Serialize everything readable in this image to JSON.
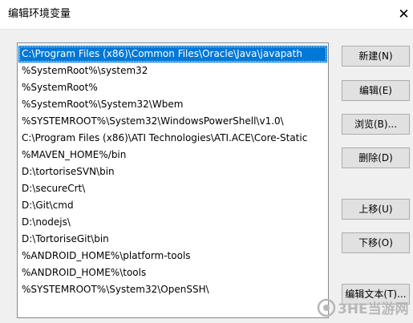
{
  "window": {
    "title": "编辑环境变量",
    "close_glyph": "✕"
  },
  "path_list": {
    "selected_index": 0,
    "items": [
      "C:\\Program Files (x86)\\Common Files\\Oracle\\Java\\javapath",
      "%SystemRoot%\\system32",
      "%SystemRoot%",
      "%SystemRoot%\\System32\\Wbem",
      "%SYSTEMROOT%\\System32\\WindowsPowerShell\\v1.0\\",
      "C:\\Program Files (x86)\\ATI Technologies\\ATI.ACE\\Core-Static",
      "%MAVEN_HOME%/bin",
      "D:\\tortoriseSVN\\bin",
      "D:\\secureCrt\\",
      "D:\\Git\\cmd",
      "D:\\nodejs\\",
      "D:\\TortoriseGit\\bin",
      "%ANDROID_HOME%\\platform-tools",
      "%ANDROID_HOME%\\tools",
      "%SYSTEMROOT%\\System32\\OpenSSH\\"
    ]
  },
  "buttons": {
    "new": "新建(N)",
    "edit": "编辑(E)",
    "browse": "浏览(B)...",
    "delete": "删除(D)",
    "move_up": "上移(U)",
    "move_down": "下移(O)",
    "edit_text": "编辑文本(T)..."
  },
  "watermark": {
    "text": "3HE当游网"
  },
  "colors": {
    "selection": "#0078d7",
    "dialog_background": "#f0f0f0",
    "button_face": "#e1e1e1",
    "watermark": "#b8b8b8"
  },
  "icons": {
    "close": "close-icon",
    "watermark_logo": "3he-logo-icon"
  }
}
